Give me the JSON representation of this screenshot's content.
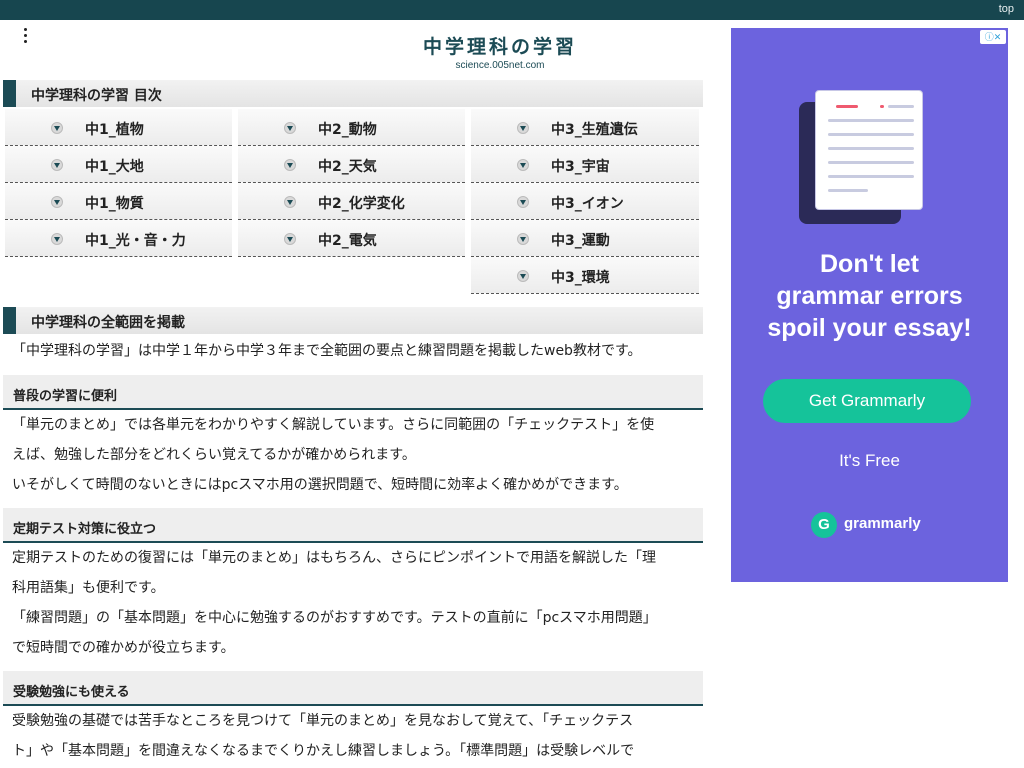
{
  "topbar": {
    "top_label": "top"
  },
  "site": {
    "title": "中学理科の学習",
    "url": "science.005net.com"
  },
  "toc": {
    "heading": "中学理科の学習 目次",
    "col1": [
      "中1_植物",
      "中1_大地",
      "中1_物質",
      "中1_光・音・力"
    ],
    "col2": [
      "中2_動物",
      "中2_天気",
      "中2_化学変化",
      "中2_電気"
    ],
    "col3": [
      "中3_生殖遺伝",
      "中3_宇宙",
      "中3_イオン",
      "中3_運動",
      "中3_環境"
    ]
  },
  "about": {
    "heading": "中学理科の全範囲を掲載",
    "intro": "「中学理科の学習」は中学１年から中学３年まで全範囲の要点と練習問題を掲載したweb教材です。",
    "sections": [
      {
        "title": "普段の学習に便利",
        "lines": [
          "「単元のまとめ」では各単元をわかりやすく解説しています。さらに同範囲の「チェックテスト」を使",
          "えば、勉強した部分をどれくらい覚えてるかが確かめられます。",
          "いそがしくて時間のないときにはpcスマホ用の選択問題で、短時間に効率よく確かめができます。"
        ]
      },
      {
        "title": "定期テスト対策に役立つ",
        "lines": [
          "定期テストのための復習には「単元のまとめ」はもちろん、さらにピンポイントで用語を解説した「理",
          "科用語集」も便利です。",
          "「練習問題」の「基本問題」を中心に勉強するのがおすすめです。テストの直前に「pcスマホ用問題」",
          "で短時間での確かめが役立ちます。"
        ]
      },
      {
        "title": "受験勉強にも使える",
        "lines": [
          "受験勉強の基礎では苦手なところを見つけて「単元のまとめ」を見なおして覚えて、「チェックテス",
          "ト」や「基本問題」を間違えなくなるまでくりかえし練習しましょう。「標準問題」は受験レベルで"
        ]
      }
    ]
  },
  "ad": {
    "headline_lines": [
      "Don't let",
      "grammar errors",
      "spoil your essay!"
    ],
    "cta": "Get Grammarly",
    "subtext": "It's Free",
    "brand": "grammarly",
    "brand_letter": "G",
    "bg_color": "#6c63de",
    "accent_color": "#15c39a"
  }
}
